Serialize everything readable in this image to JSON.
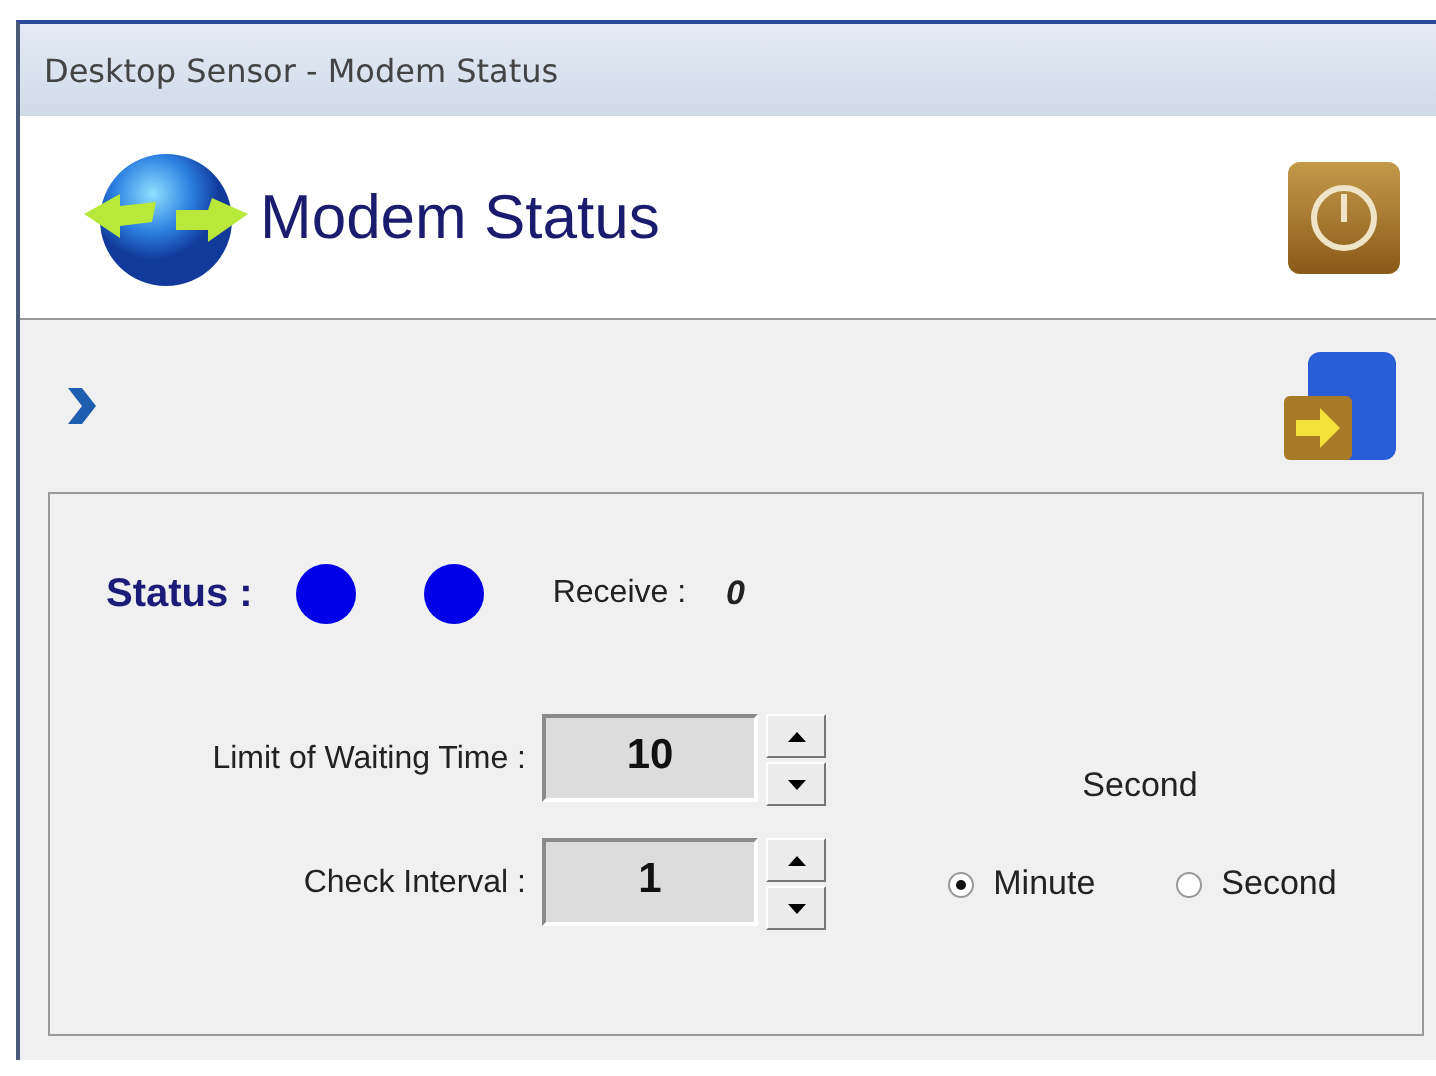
{
  "window": {
    "title": "Desktop Sensor - Modem Status"
  },
  "header": {
    "title": "Modem Status"
  },
  "status": {
    "label": "Status :",
    "indicators": [
      {
        "color": "#0000e6"
      },
      {
        "color": "#0000e6"
      }
    ],
    "receive_label": "Receive :",
    "receive_value": "0"
  },
  "waiting_time": {
    "label": "Limit of Waiting Time :",
    "value": "10",
    "unit": "Second"
  },
  "check_interval": {
    "label": "Check Interval :",
    "value": "1",
    "options": [
      {
        "label": "Minute",
        "selected": true
      },
      {
        "label": "Second",
        "selected": false
      }
    ]
  }
}
